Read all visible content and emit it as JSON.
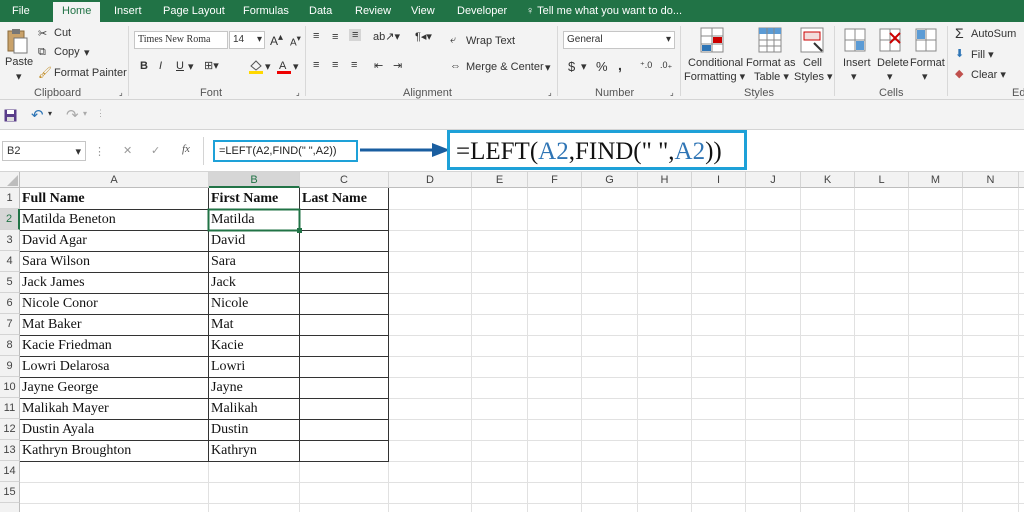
{
  "tabs": [
    "File",
    "Home",
    "Insert",
    "Page Layout",
    "Formulas",
    "Data",
    "Review",
    "View",
    "Developer"
  ],
  "tell_me": "Tell me what you want to do...",
  "clipboard": {
    "paste": "Paste",
    "cut": "Cut",
    "copy": "Copy",
    "format_painter": "Format Painter",
    "label": "Clipboard"
  },
  "font": {
    "name": "Times New Roma",
    "size": "14",
    "bold": "B",
    "italic": "I",
    "underline": "U",
    "label": "Font"
  },
  "alignment": {
    "wrap": "Wrap Text",
    "merge": "Merge & Center",
    "label": "Alignment"
  },
  "number": {
    "format": "General",
    "currency": "$",
    "percent": "%",
    "comma": ",",
    "label": "Number"
  },
  "styles": {
    "conditional": "Conditional",
    "formatting": "Formatting",
    "format_as": "Format as",
    "table": "Table",
    "cell": "Cell",
    "styles_word": "Styles",
    "label": "Styles"
  },
  "cells": {
    "insert": "Insert",
    "delete": "Delete",
    "format": "Format",
    "label": "Cells"
  },
  "editing": {
    "autosum": "AutoSum",
    "fill": "Fill",
    "clear": "Clear",
    "label": "Ed"
  },
  "name_box": "B2",
  "fx": "fx",
  "formula": "=LEFT(A2,FIND(\" \",A2))",
  "callout": {
    "a": "=LEFT(",
    "b": "A2",
    "c": ",FIND(\" \",",
    "d": "A2",
    "e": "))"
  },
  "columns": [
    "A",
    "B",
    "C",
    "D",
    "E",
    "F",
    "G",
    "H",
    "I",
    "J",
    "K",
    "L",
    "M",
    "N"
  ],
  "rows": [
    "1",
    "2",
    "3",
    "4",
    "5",
    "6",
    "7",
    "8",
    "9",
    "10",
    "11",
    "12",
    "13",
    "14",
    "15"
  ],
  "headers": {
    "a": "Full Name",
    "b": "First Name",
    "c": "Last Name"
  },
  "full_names": [
    "Matilda Beneton",
    "David Agar",
    "Sara Wilson",
    "Jack James",
    "Nicole Conor",
    "Mat Baker",
    "Kacie Friedman",
    "Lowri Delarosa",
    "Jayne George",
    "Malikah Mayer",
    "Dustin Ayala",
    "Kathryn Broughton"
  ],
  "first_names": [
    "Matilda",
    "David",
    "Sara",
    "Jack",
    "Nicole",
    "Mat",
    "Kacie",
    "Lowri",
    "Jayne",
    "Malikah",
    "Dustin",
    "Kathryn"
  ],
  "colors": {
    "brand": "#217346",
    "accent": "#1ea1d8",
    "formula_ref": "#2f75b5",
    "selected": "#217346"
  }
}
